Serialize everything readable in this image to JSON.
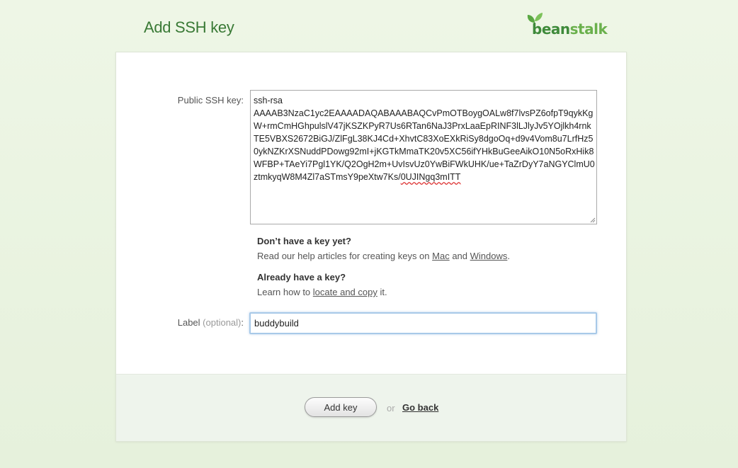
{
  "page": {
    "title": "Add SSH key"
  },
  "logo": {
    "text_bean": "bean",
    "text_stalk": "stalk",
    "brand_color": "#3e8a3a",
    "accent_color": "#6ab04c"
  },
  "form": {
    "public_key_label": "Public SSH key:",
    "public_key_value": "ssh-rsa\nAAAAB3NzaC1yc2EAAAADAQABAAABAQCvPmOTBoygOALw8f7lvsPZ6ofpT9qykKgW+rmCmHGhpulslV47jKSZKPyR7Us6RTan6NaJ3PrxLaaEpRINF3lLJlyJv5YOjlkh4rnkTE5VBXS2672BiGJ/ZlFgL38KJ4Cd+XhvtC83XoEXkRiSy8dgoOq+d9v4Vom8u7LrfHz50ykNZKrXSNuddPDowg92mI+jKGTkMmaTK20v5XC56ifYHkBuGeeAikO10N5oRxHik8WFBP+TAeYi7Pgl1YK/Q2OgH2m+UvIsvUz0YwBiFWkUHK/ue+TaZrDyY7aNGYClmU0ztmkyqW8M4Zl7aSTmsY9peXtw7Ks/",
    "public_key_tail": "0UJINgq3mITT",
    "help_no_key": {
      "heading": "Don’t have a key yet?",
      "text_before": "Read our help articles for creating keys on ",
      "link_mac": "Mac",
      "text_and": " and ",
      "link_windows": "Windows",
      "text_after": "."
    },
    "help_have_key": {
      "heading": "Already have a key?",
      "text_before": "Learn how to ",
      "link_locate": "locate and copy",
      "text_after": " it."
    },
    "label_label": "Label",
    "label_optional": "(optional)",
    "label_colon": ":",
    "label_value": "buddybuild"
  },
  "actions": {
    "add_key_label": "Add key",
    "or_text": "or",
    "go_back_label": "Go back"
  }
}
